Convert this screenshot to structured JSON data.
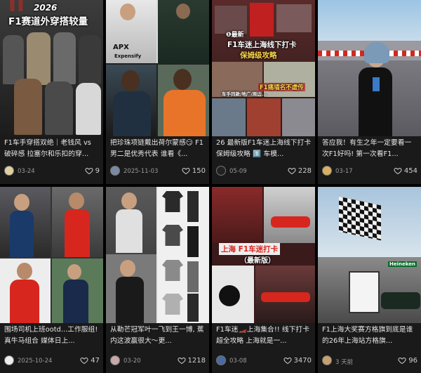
{
  "cards": [
    {
      "overlay": [
        "2026",
        "F1赛道外穿搭较量"
      ],
      "caption": "F1车手穿搭双绝｜老钱风 vs 破碎感 拉塞尔和乐扣的穿...",
      "date": "03-24",
      "likes": "9"
    },
    {
      "overlay": [
        "APX",
        "Expensify"
      ],
      "caption": "把珍珠项链戴出荷尔蒙感😏 F1男二是优秀代表 谁看《...",
      "date": "2025-11-03",
      "likes": "150"
    },
    {
      "overlay": [
        "❶最新",
        "F1车迷上海线下打卡",
        "保姆级攻略",
        "F1痛墙名不虚传",
        "车手同款/地广/周边..."
      ],
      "caption": "26 最新版F1车迷上海线下打卡保姆级攻略 1️⃣ 车模...",
      "date": "05-09",
      "likes": "228"
    },
    {
      "overlay": [],
      "caption": "答应我！有生之年一定要看一次F1好吗! 第一次看F1...",
      "date": "03-17",
      "likes": "454"
    },
    {
      "overlay": [],
      "caption": "围场司机上班ootd...工作服组! 真牛马组合 媒体日上...",
      "date": "2025-10-24",
      "likes": "47"
    },
    {
      "overlay": [],
      "caption": "从勒芒冠军叶一飞到王一博, 蕉内这波赢很大～更...",
      "date": "03-20",
      "likes": "1218"
    },
    {
      "overlay": [
        "上海 F1车迷打卡",
        "（最新版）"
      ],
      "caption": "F1车迷🏎️上海集合!! 线下打卡超全攻略 上海就是一...",
      "date": "03-08",
      "likes": "3470"
    },
    {
      "overlay": [
        "Heineken"
      ],
      "caption": "F1上海大奖赛方格旗到底是谁的26年上海站方格旗...",
      "date": "3 天前",
      "likes": "96"
    }
  ],
  "colors": {
    "background": "#000000",
    "caption": "#e8e8e8",
    "meta": "#9a9a9a",
    "f1_red": "#d7261e"
  }
}
